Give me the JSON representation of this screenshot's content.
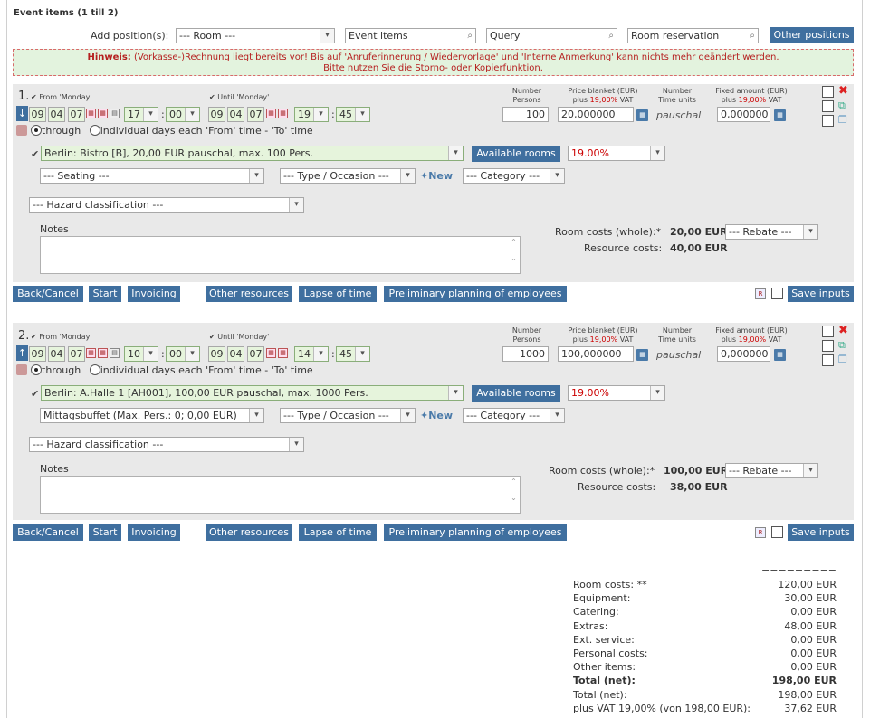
{
  "header": {
    "title": "Event items (1 till 2)"
  },
  "top": {
    "add_label": "Add position(s):",
    "room_select": "--- Room ---",
    "event_items": "Event items",
    "query": "Query",
    "room_reservation": "Room reservation",
    "other_positions": "Other positions"
  },
  "notice": {
    "prefix": "Hinweis:",
    "line1": " (Vorkasse-)Rechnung liegt bereits vor! Bis auf 'Anruferinnerung / Wiedervorlage' und 'Interne Anmerkung' kann nichts mehr geändert werden.",
    "line2": "Bitte nutzen Sie die Storno- oder Kopierfunktion."
  },
  "columns": {
    "number_persons_1": "Number",
    "number_persons_2": "Persons",
    "price_blanket_1": "Price blanket (EUR)",
    "price_blanket_2a": "plus ",
    "price_blanket_vat": "19,00%",
    "price_blanket_2b": " VAT",
    "time_units_1": "Number",
    "time_units_2": "Time units",
    "fixed_amount_1": "Fixed amount (EUR)",
    "fixed_amount_2a": "plus ",
    "fixed_amount_vat": "19,00%",
    "fixed_amount_2b": " VAT"
  },
  "common": {
    "from": "From 'Monday'",
    "until": "Until 'Monday'",
    "through": "through",
    "individual": "individual days each 'From' time - 'To' time",
    "seating": "--- Seating ---",
    "type_occasion": "--- Type / Occasion ---",
    "new": "New",
    "category": "--- Category ---",
    "hazard": "--- Hazard classification ---",
    "notes": "Notes",
    "available_rooms": "Available rooms",
    "vat": "19.00%",
    "room_costs_label": "Room costs (whole):*",
    "rebate": "--- Rebate ---",
    "resource_costs_label": "Resource costs:",
    "pauschal": "pauschal",
    "buttons": {
      "back": "Back/Cancel",
      "start": "Start",
      "invoicing": "Invoicing",
      "other_resources": "Other resources",
      "lapse": "Lapse of time",
      "preliminary": "Preliminary planning of employees",
      "save": "Save inputs"
    }
  },
  "items": [
    {
      "num": "1.",
      "from_day": "09",
      "from_month": "04",
      "from_year": "07",
      "from_hour": "17",
      "from_min": "00",
      "until_day": "09",
      "until_month": "04",
      "until_year": "07",
      "until_hour": "19",
      "until_min": "45",
      "persons": "100",
      "price": "20,000000",
      "fixed": "0,000000",
      "room": "Berlin: Bistro [B], 20,00 EUR pauschal, max. 100 Pers.",
      "seating": "--- Seating ---",
      "room_costs": "20,00 EUR",
      "resource_costs": "40,00 EUR"
    },
    {
      "num": "2.",
      "from_day": "09",
      "from_month": "04",
      "from_year": "07",
      "from_hour": "10",
      "from_min": "00",
      "until_day": "09",
      "until_month": "04",
      "until_year": "07",
      "until_hour": "14",
      "until_min": "45",
      "persons": "1000",
      "price": "100,000000",
      "fixed": "0,000000",
      "room": "Berlin: A.Halle 1 [AH001], 100,00 EUR pauschal, max. 1000 Pers.",
      "seating": "Mittagsbuffet (Max. Pers.: 0; 0,00 EUR)",
      "room_costs": "100,00 EUR",
      "resource_costs": "38,00 EUR"
    }
  ],
  "summary": {
    "separator": "=========",
    "rows": [
      {
        "label": "Room costs: **",
        "value": "120,00 EUR",
        "bold": false
      },
      {
        "label": "Equipment:",
        "value": "30,00 EUR",
        "bold": false
      },
      {
        "label": "Catering:",
        "value": "0,00 EUR",
        "bold": false
      },
      {
        "label": "Extras:",
        "value": "48,00 EUR",
        "bold": false
      },
      {
        "label": "Ext. service:",
        "value": "0,00 EUR",
        "bold": false
      },
      {
        "label": "Personal costs:",
        "value": "0,00 EUR",
        "bold": false
      },
      {
        "label": "Other items:",
        "value": "0,00 EUR",
        "bold": false
      },
      {
        "label": "Total (net):",
        "value": "198,00 EUR",
        "bold": true
      },
      {
        "label": "Total (net):",
        "value": "198,00 EUR",
        "bold": false
      },
      {
        "label": "plus VAT 19,00% (von 198,00 EUR):",
        "value": "37,62 EUR",
        "bold": false
      }
    ]
  }
}
